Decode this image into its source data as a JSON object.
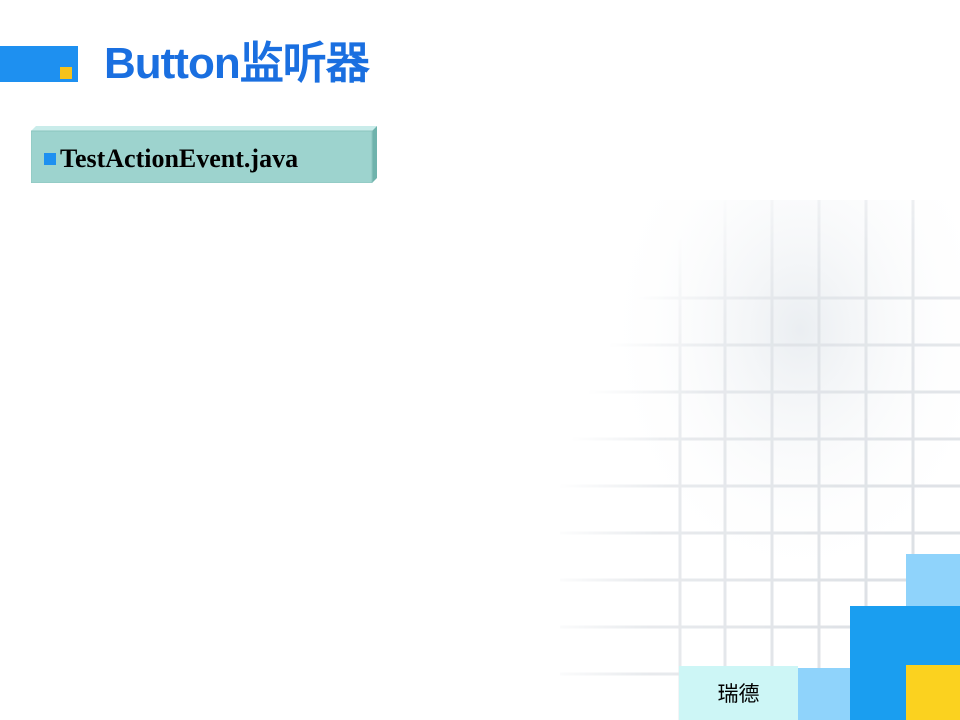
{
  "slide": {
    "title": "Button监听器",
    "item": "TestActionEvent.java",
    "footer": "瑞德"
  },
  "colors": {
    "title": "#1a6fe0",
    "accent_blue": "#1e90f0",
    "accent_yellow": "#f5c21b",
    "box_face": "#9dd3ce",
    "footer_bg": "#cdf6f6"
  }
}
